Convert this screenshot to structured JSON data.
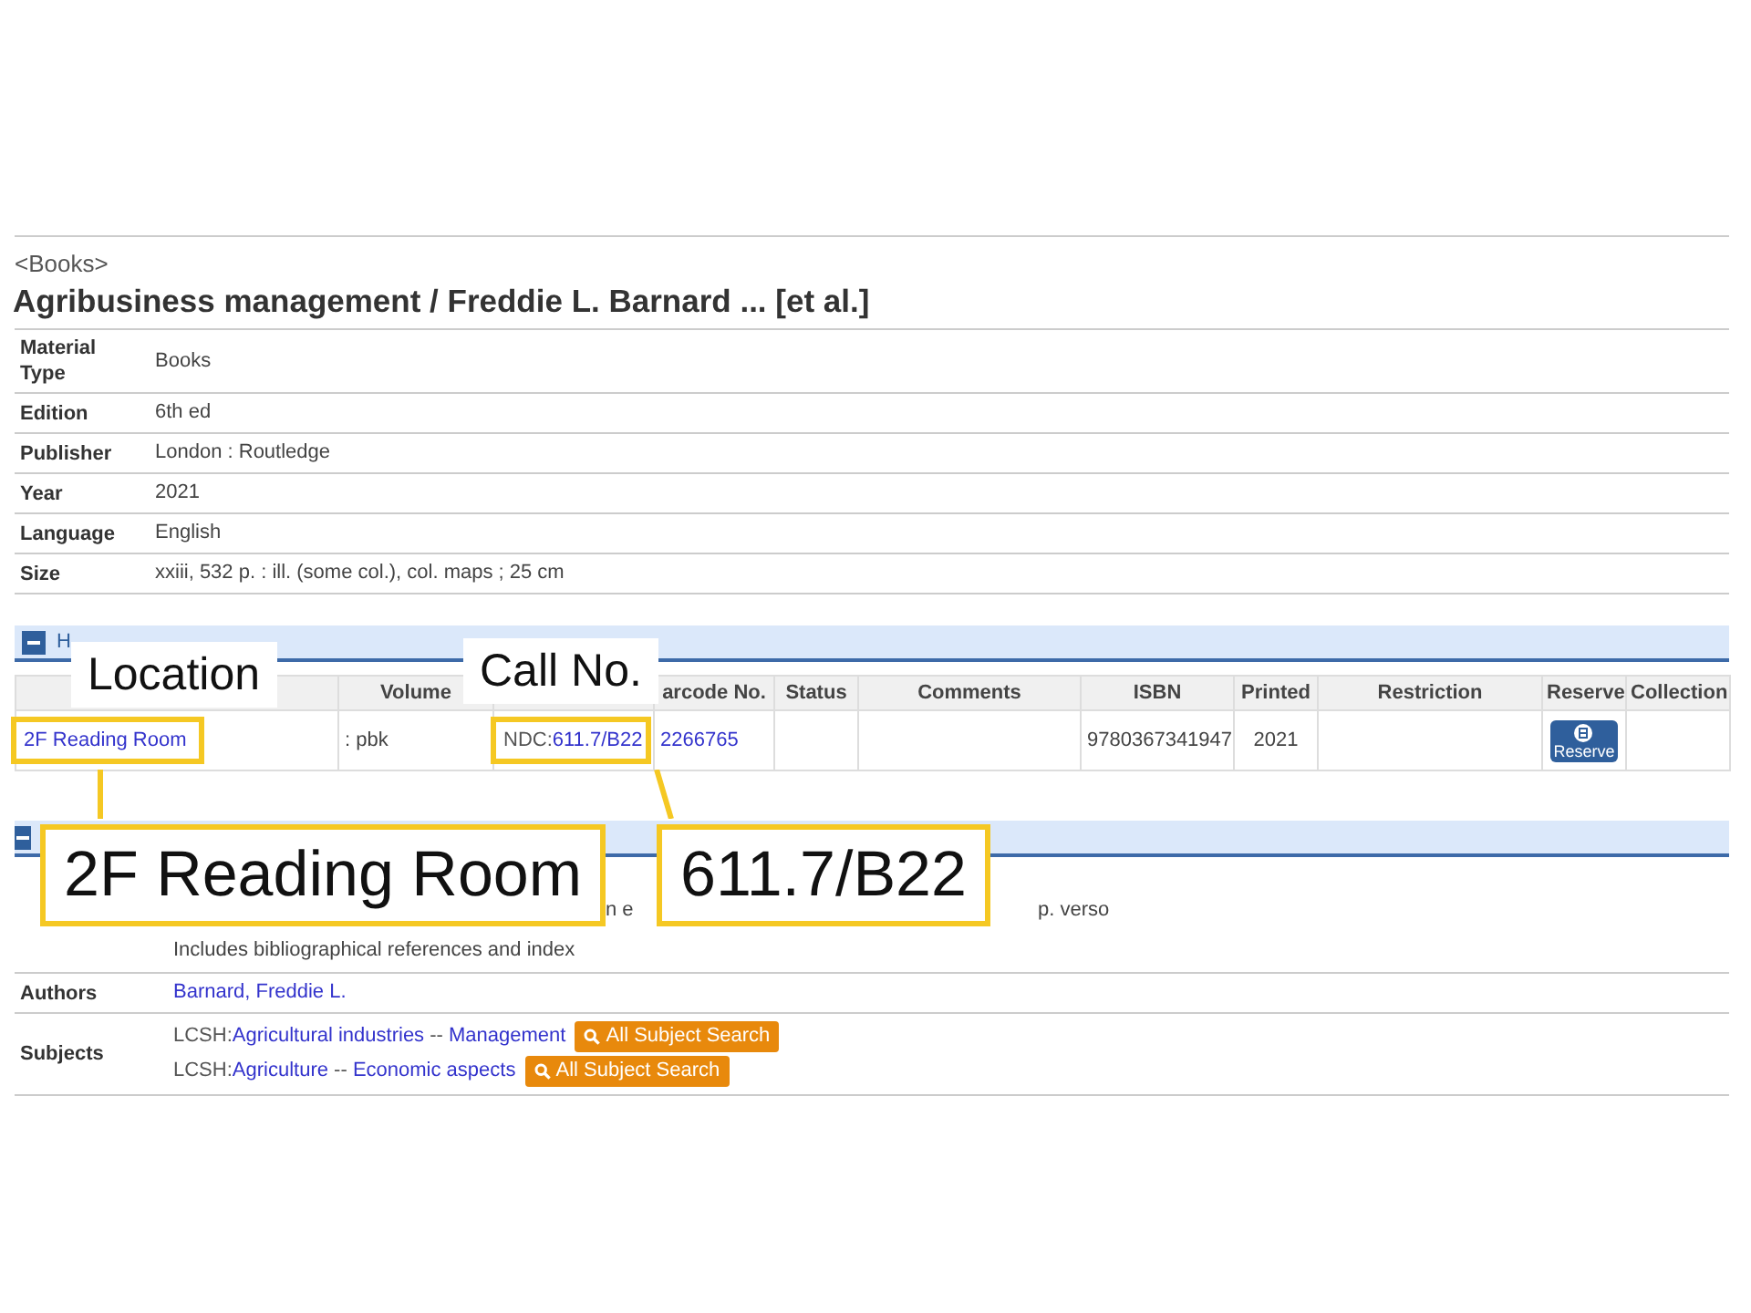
{
  "record": {
    "type_label": "<Books>",
    "title": "Agribusiness management / Freddie L. Barnard ... [et al.]",
    "fields": [
      {
        "label": "Material Type",
        "value": "Books"
      },
      {
        "label": "Edition",
        "value": "6th ed"
      },
      {
        "label": "Publisher",
        "value": "London : Routledge"
      },
      {
        "label": "Year",
        "value": "2021"
      },
      {
        "label": "Language",
        "value": "English"
      },
      {
        "label": "Size",
        "value": "xxiii, 532 p. : ill. (some col.), col. maps ; 25 cm"
      }
    ]
  },
  "holdings": {
    "section_title": "H",
    "expanded": true,
    "columns": [
      "",
      "Volume",
      "",
      "arcode No.",
      "Status",
      "Comments",
      "ISBN",
      "Printed",
      "Restriction",
      "Reserve",
      "Collection"
    ],
    "rows": [
      {
        "location": "2F Reading Room",
        "volume": ": pbk",
        "call_prefix": "NDC:",
        "call_no": "611.7/B22",
        "barcode": "2266765",
        "status": "",
        "comments": "",
        "isbn": "9780367341947",
        "printed": "2021",
        "restriction": "",
        "reserve_button": "Reserve",
        "collection": ""
      }
    ]
  },
  "details": {
    "expanded": true,
    "notes_fragments": [
      "n e",
      "p. verso"
    ],
    "notes_line": "Includes bibliographical references and index",
    "authors_label": "Authors",
    "authors": "Barnard, Freddie L.",
    "subjects_label": "Subjects",
    "subjects": [
      {
        "scheme": "LCSH:",
        "terms": [
          "Agricultural industries",
          "Management"
        ],
        "separator": "--",
        "button": "All Subject Search"
      },
      {
        "scheme": "LCSH:",
        "terms": [
          "Agriculture",
          "Economic aspects"
        ],
        "separator": "--",
        "button": "All Subject Search"
      }
    ]
  },
  "callouts": [
    {
      "label": "Location",
      "value": "2F Reading Room"
    },
    {
      "label": "Call No.",
      "value": "611.7/B22"
    }
  ]
}
